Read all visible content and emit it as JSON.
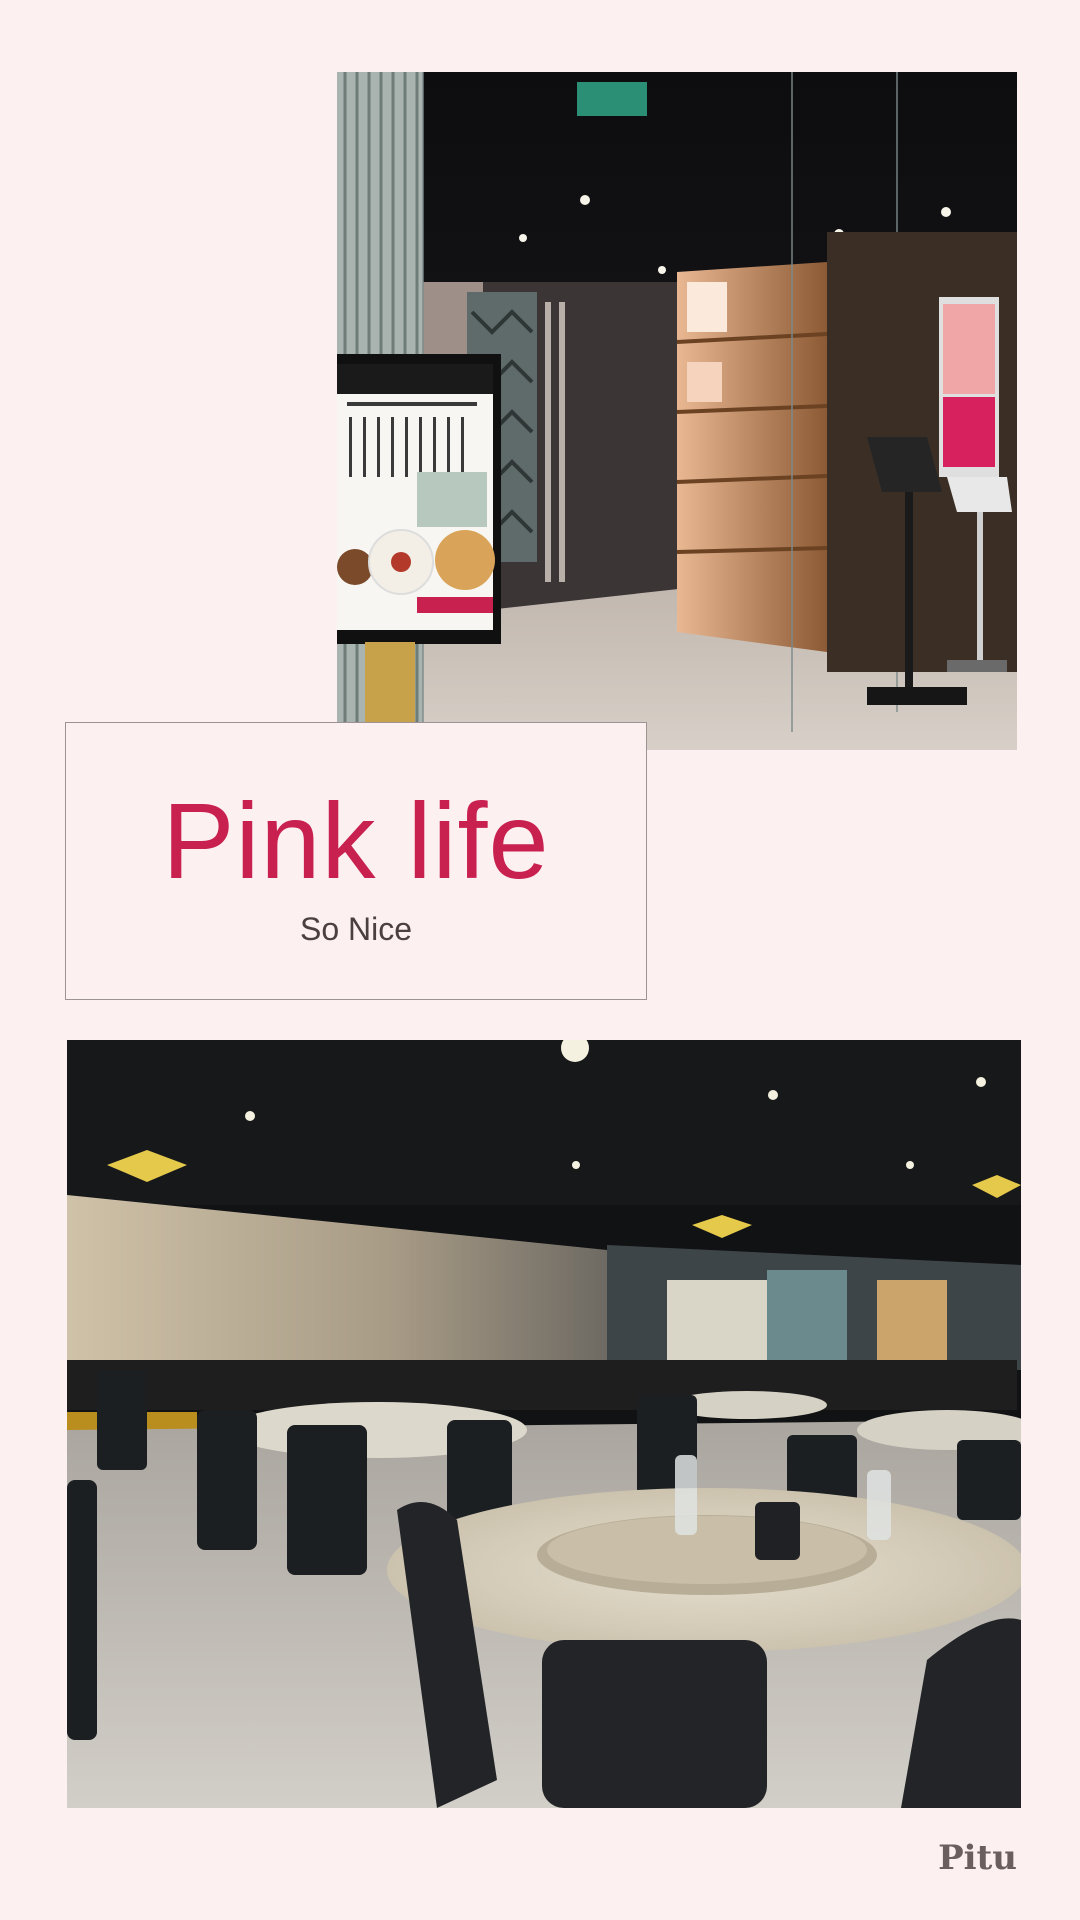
{
  "card": {
    "title": "Pink life",
    "subtitle": "So Nice"
  },
  "watermark": "Pitu",
  "photos": {
    "top": "restaurant-entrance",
    "bottom": "dining-hall"
  },
  "colors": {
    "background": "#fcf0f0",
    "title": "#c8204f",
    "subtitle": "#4a4040",
    "card_border": "#9c9494",
    "watermark": "#6b5e5e"
  }
}
